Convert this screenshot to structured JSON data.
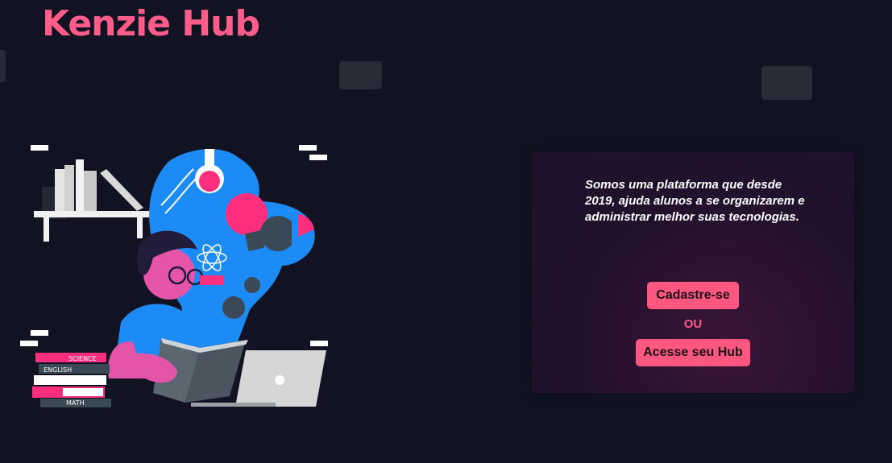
{
  "brand": {
    "logo_text": "Kenzie Hub",
    "accent_color": "#ff577f",
    "background_color": "#121322"
  },
  "hero": {
    "description": "Somos uma plataforma que desde 2019, ajuda alunos a se organizarem e administrar melhor suas tecnologias.",
    "register_label": "Cadastre-se",
    "or_label": "OU",
    "login_label": "Acesse seu Hub"
  },
  "illustration": {
    "icon": "student-studying-illustration",
    "book_labels": [
      "SCIENCE",
      "ENGLISH",
      "MATH"
    ]
  }
}
